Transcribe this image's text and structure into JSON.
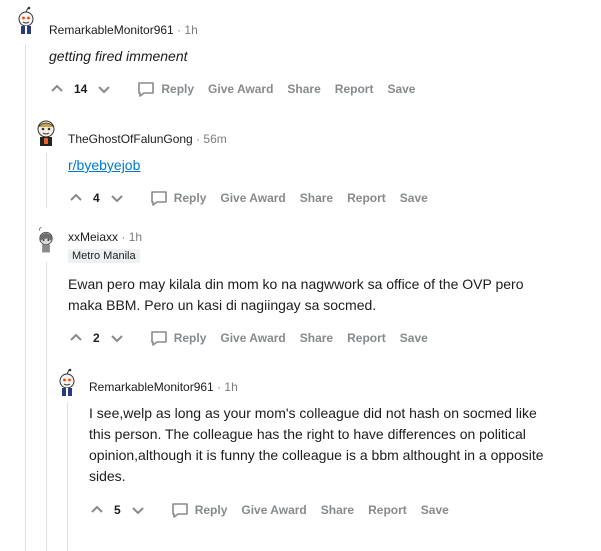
{
  "comments": [
    {
      "username": "RemarkableMonitor961",
      "time": "1h",
      "body": "getting fired immenent",
      "score": "14"
    },
    {
      "username": "TheGhostOfFalunGong",
      "time": "56m",
      "link": "r/byebyejob",
      "score": "4"
    },
    {
      "username": "xxMeiaxx",
      "time": "1h",
      "flair": "Metro Manila",
      "body_lines": [
        "Ewan pero may kilala din mom ko na nagwwork sa office of the OVP pero",
        "maka BBM. Pero un kasi di nagiingay sa socmed."
      ],
      "score": "2"
    },
    {
      "username": "RemarkableMonitor961",
      "time": "1h",
      "body_lines": [
        "I see,welp as long as your mom's colleague did not hash on socmed like",
        "this person. The colleague has the right to have differences on political",
        "opinion,although it is funny the colleague is a bbm althought in a opposite",
        "sides."
      ],
      "score": "5"
    }
  ],
  "actions": {
    "reply": "Reply",
    "give_award": "Give Award",
    "share": "Share",
    "report": "Report",
    "save": "Save"
  },
  "separator": "·"
}
